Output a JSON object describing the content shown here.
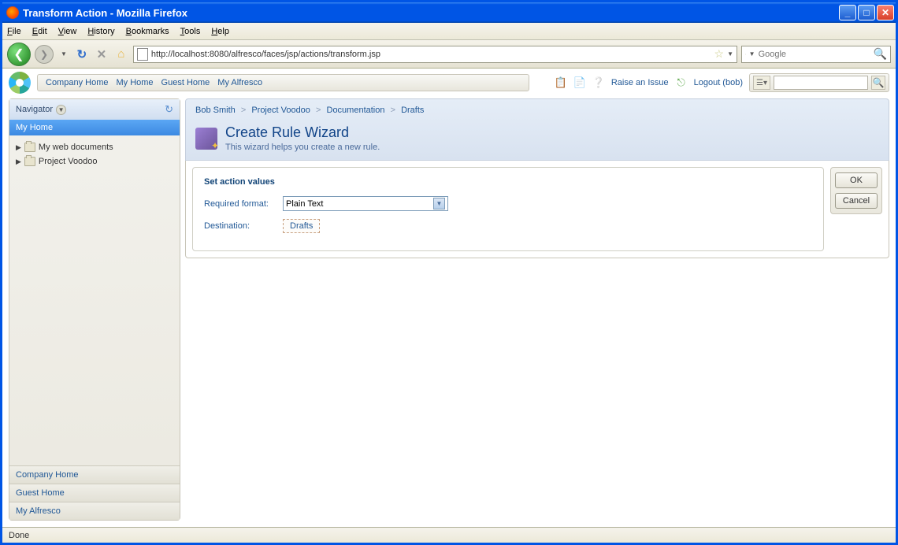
{
  "window": {
    "title": "Transform Action - Mozilla Firefox"
  },
  "menubar": [
    "File",
    "Edit",
    "View",
    "History",
    "Bookmarks",
    "Tools",
    "Help"
  ],
  "url": "http://localhost:8080/alfresco/faces/jsp/actions/transform.jsp",
  "search_placeholder": "Google",
  "nav_links": [
    "Company Home",
    "My Home",
    "Guest Home",
    "My Alfresco"
  ],
  "top_actions": {
    "raise_issue": "Raise an Issue",
    "logout": "Logout (bob)"
  },
  "sidebar": {
    "title": "Navigator",
    "selected": "My Home",
    "tree": [
      "My web documents",
      "Project Voodoo"
    ],
    "bottom": [
      "Company Home",
      "Guest Home",
      "My Alfresco"
    ]
  },
  "breadcrumb": [
    "Bob Smith",
    "Project Voodoo",
    "Documentation",
    "Drafts"
  ],
  "page": {
    "title": "Create Rule Wizard",
    "subtitle": "This wizard helps you create a new rule."
  },
  "form": {
    "heading": "Set action values",
    "required_format_label": "Required format:",
    "required_format_value": "Plain Text",
    "destination_label": "Destination:",
    "destination_value": "Drafts"
  },
  "buttons": {
    "ok": "OK",
    "cancel": "Cancel"
  },
  "status": "Done"
}
